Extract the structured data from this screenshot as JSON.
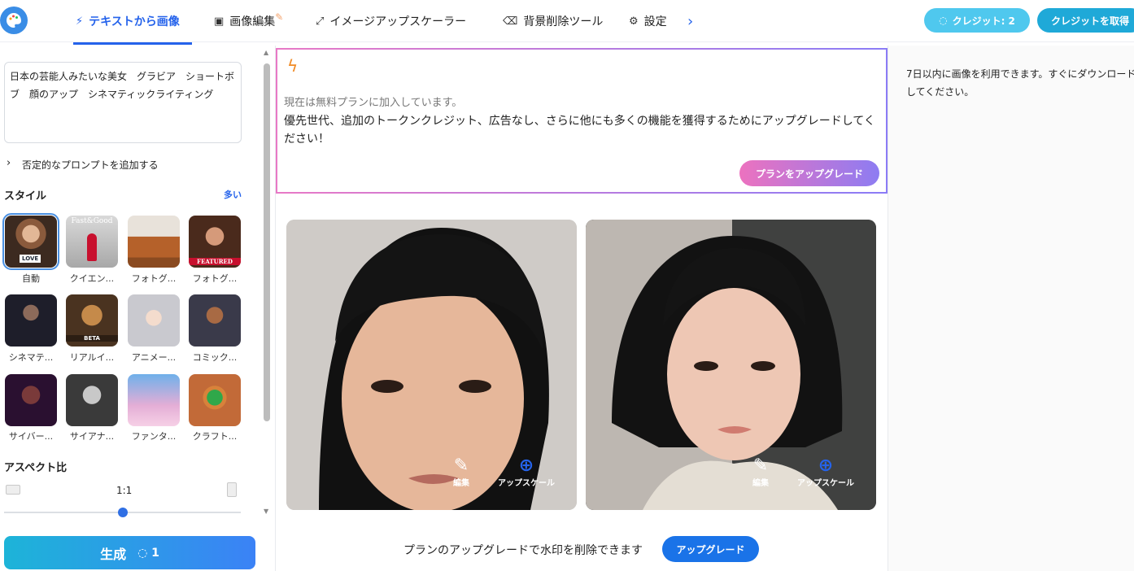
{
  "nav": {
    "tabs": [
      {
        "label": "テキストから画像",
        "icon": "magic-wand-icon"
      },
      {
        "label": "画像編集",
        "icon": "image-icon"
      },
      {
        "label": "イメージアップスケーラー",
        "icon": "expand-icon"
      },
      {
        "label": "背景削除ツール",
        "icon": "eraser-icon"
      },
      {
        "label": "設定",
        "icon": "gear-icon"
      }
    ],
    "credits_label": "クレジット: 2",
    "get_credits_label": "クレジットを取得",
    "accent_color": "#2563eb"
  },
  "left": {
    "prompt_text": "日本の芸能人みたいな美女　グラビア　ショートボブ　顔のアップ　シネマティックライティング",
    "negative_prompt_label": "否定的なプロンプトを追加する",
    "style_heading": "スタイル",
    "more_label": "多い",
    "styles": [
      {
        "label": "自動",
        "badge": "LOVE"
      },
      {
        "label": "クイエン...",
        "badge": "Fast&Good"
      },
      {
        "label": "フォトグ..."
      },
      {
        "label": "フォトグ...",
        "badge": "FEATURED"
      },
      {
        "label": "シネマテ..."
      },
      {
        "label": "リアルイ...",
        "badge": "BETA"
      },
      {
        "label": "アニメー..."
      },
      {
        "label": "コミック..."
      },
      {
        "label": "サイバー..."
      },
      {
        "label": "サイアナ..."
      },
      {
        "label": "ファンタ..."
      },
      {
        "label": "クラフト..."
      }
    ],
    "aspect_heading": "アスペクト比",
    "aspect_value": "1:1",
    "aspect_slider_fraction": 0.5,
    "generate_label": "生成",
    "generate_cost": "1"
  },
  "center": {
    "upsell_status": "現在は無料プランに加入しています。",
    "upsell_message": "優先世代、追加のトークンクレジット、広告なし、さらに他にも多くの機能を獲得するためにアップグレードしてください！",
    "upsell_button": "プランをアップグレード",
    "images": [
      {
        "edit_label": "編集",
        "upscale_label": "アップスケール"
      },
      {
        "edit_label": "編集",
        "upscale_label": "アップスケール"
      }
    ],
    "watermark_text": "プランのアップグレードで水印を削除できます",
    "watermark_button": "アップグレード"
  },
  "right": {
    "notice": "7日以内に画像を利用できます。すぐにダウンロードしてください。"
  }
}
